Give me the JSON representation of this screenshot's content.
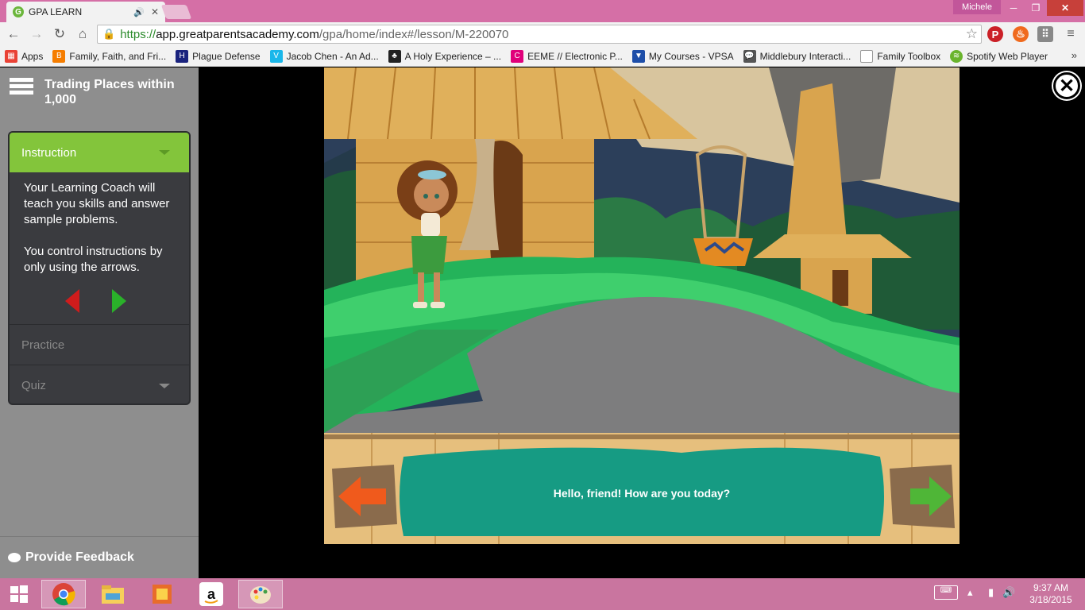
{
  "browser": {
    "tab_title": "GPA LEARN",
    "tab_favicon": "G",
    "user_name": "Michele",
    "url_scheme": "https://",
    "url_host": "app.greatparentsacademy.com",
    "url_path": "/gpa/home/index#/lesson/M-220070",
    "bookmarks": [
      {
        "label": "Apps",
        "icon": "apps-grid-icon",
        "color": "#e94235"
      },
      {
        "label": "Family, Faith, and Fri...",
        "icon": "blogger-icon",
        "color": "#f57d00"
      },
      {
        "label": "Plague Defense",
        "icon": "hf-icon",
        "color": "#1a237e"
      },
      {
        "label": "Jacob Chen - An Ad...",
        "icon": "vimeo-icon",
        "color": "#1ab7ea"
      },
      {
        "label": "A Holy Experience – ...",
        "icon": "tree-icon",
        "color": "#222222"
      },
      {
        "label": "EEME // Electronic P...",
        "icon": "eeme-icon",
        "color": "#e0007a"
      },
      {
        "label": "My Courses - VPSA",
        "icon": "shield-icon",
        "color": "#1e4ea8"
      },
      {
        "label": "Middlebury Interacti...",
        "icon": "chat-icon",
        "color": "#555555"
      },
      {
        "label": "Family Toolbox",
        "icon": "page-icon",
        "color": "#dddddd"
      },
      {
        "label": "Spotify Web Player",
        "icon": "spotify-icon",
        "color": "#6ab42d"
      }
    ],
    "bookmark_more": "»"
  },
  "sidebar": {
    "lesson_title": "Trading Places within 1,000",
    "instruction_label": "Instruction",
    "instruction_text_1": "Your Learning Coach will teach you skills and answer sample problems.",
    "instruction_text_2": "You control instructions by only using the arrows.",
    "practice_label": "Practice",
    "quiz_label": "Quiz",
    "feedback_label": "Provide Feedback"
  },
  "game": {
    "dialog": "Hello, friend! How are you today?"
  },
  "taskbar": {
    "time": "9:37 AM",
    "date": "3/18/2015",
    "apps": [
      "chrome-icon",
      "file-explorer-icon",
      "office-icon",
      "amazon-icon",
      "paint-icon"
    ]
  }
}
